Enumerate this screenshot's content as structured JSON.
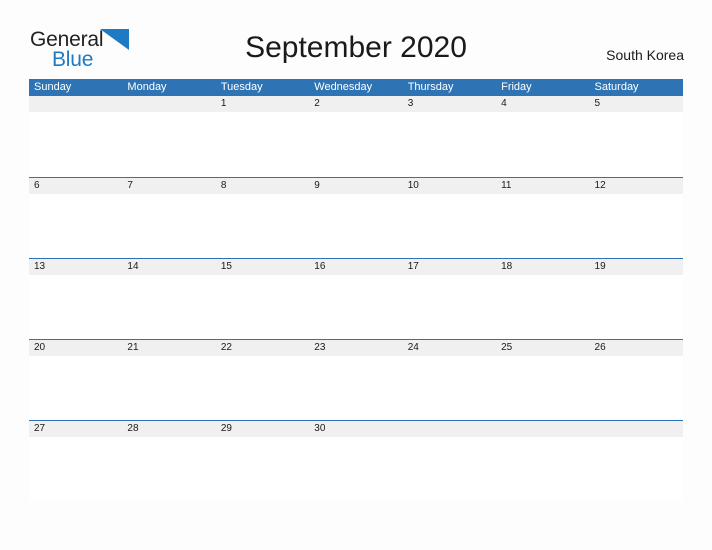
{
  "branding": {
    "logo_text_primary": "General",
    "logo_text_secondary": "Blue",
    "logo_flag_icon": "blue-triangle-flag-icon",
    "accent_color": "#2e74b5",
    "logo_blue": "#1f7ac4"
  },
  "header": {
    "title": "September 2020",
    "region": "South Korea"
  },
  "calendar": {
    "month": "September",
    "year": "2020",
    "weekdays": [
      "Sunday",
      "Monday",
      "Tuesday",
      "Wednesday",
      "Thursday",
      "Friday",
      "Saturday"
    ],
    "header_bg": "#2e74b5",
    "header_text_color": "#ffffff",
    "day_band_bg": "#f0f0f0",
    "cell_bg": "#ffffff",
    "row_border_color": "#2e74b5",
    "weeks": [
      {
        "days": [
          {
            "label": "",
            "empty": true
          },
          {
            "label": "",
            "empty": true
          },
          {
            "label": "1",
            "empty": false
          },
          {
            "label": "2",
            "empty": false
          },
          {
            "label": "3",
            "empty": false
          },
          {
            "label": "4",
            "empty": false
          },
          {
            "label": "5",
            "empty": false
          }
        ]
      },
      {
        "days": [
          {
            "label": "6",
            "empty": false
          },
          {
            "label": "7",
            "empty": false
          },
          {
            "label": "8",
            "empty": false
          },
          {
            "label": "9",
            "empty": false
          },
          {
            "label": "10",
            "empty": false
          },
          {
            "label": "11",
            "empty": false
          },
          {
            "label": "12",
            "empty": false
          }
        ]
      },
      {
        "days": [
          {
            "label": "13",
            "empty": false
          },
          {
            "label": "14",
            "empty": false
          },
          {
            "label": "15",
            "empty": false
          },
          {
            "label": "16",
            "empty": false
          },
          {
            "label": "17",
            "empty": false
          },
          {
            "label": "18",
            "empty": false
          },
          {
            "label": "19",
            "empty": false
          }
        ]
      },
      {
        "days": [
          {
            "label": "20",
            "empty": false
          },
          {
            "label": "21",
            "empty": false
          },
          {
            "label": "22",
            "empty": false
          },
          {
            "label": "23",
            "empty": false
          },
          {
            "label": "24",
            "empty": false
          },
          {
            "label": "25",
            "empty": false
          },
          {
            "label": "26",
            "empty": false
          }
        ]
      },
      {
        "days": [
          {
            "label": "27",
            "empty": false
          },
          {
            "label": "28",
            "empty": false
          },
          {
            "label": "29",
            "empty": false
          },
          {
            "label": "30",
            "empty": false
          },
          {
            "label": "",
            "empty": true
          },
          {
            "label": "",
            "empty": true
          },
          {
            "label": "",
            "empty": true
          }
        ]
      }
    ]
  }
}
